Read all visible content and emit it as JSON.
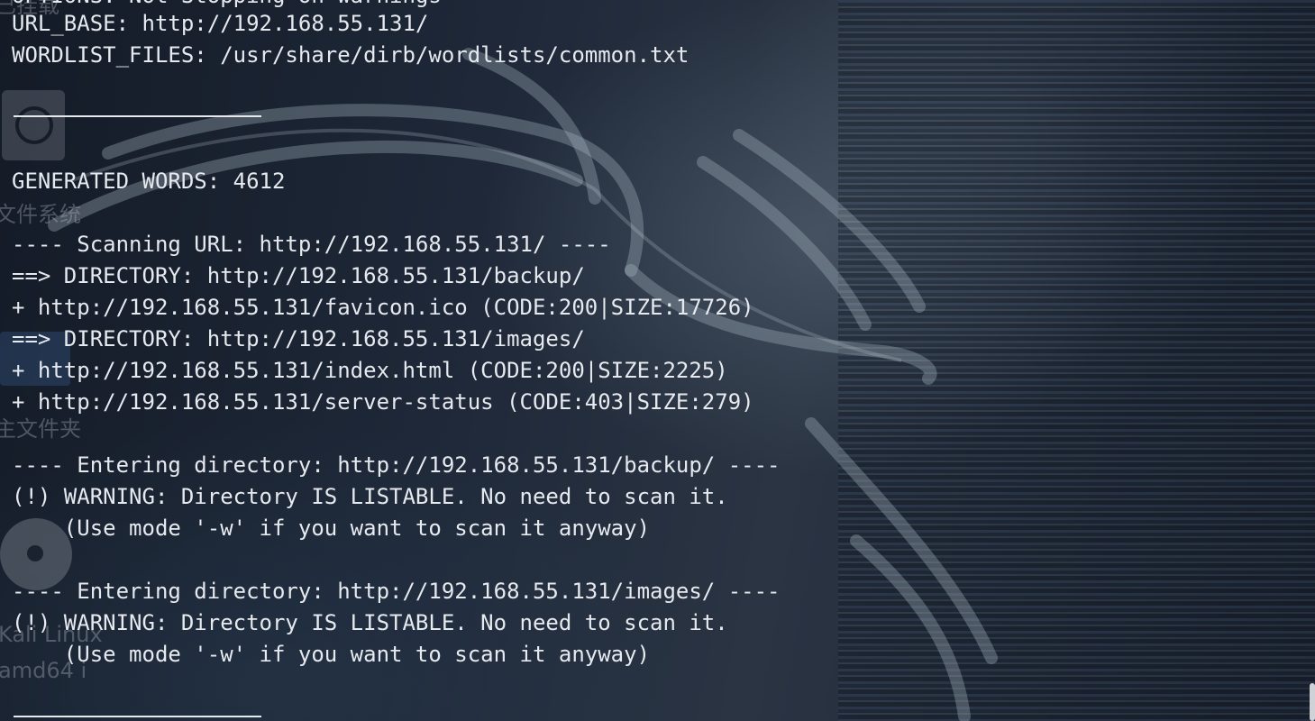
{
  "desktop": {
    "icons": [
      {
        "name": "trash-icon",
        "label": "文件系统"
      },
      {
        "name": "folder-icon",
        "label": "主文件夹"
      },
      {
        "name": "disc-icon",
        "label": "Kali Linux amd64 i"
      }
    ],
    "label_trash": "文件系统",
    "label_home": "主文件夹",
    "label_disc_1": "Kali Linux",
    "label_disc_2": "amd64 i",
    "label_top": "已挂载"
  },
  "terminal": {
    "lines": {
      "top_partial": "OPTIONS: Not Stopping on warnings",
      "url_base": "URL_BASE: http://192.168.55.131/",
      "wordlist": "WORDLIST_FILES: /usr/share/dirb/wordlists/common.txt",
      "generated_words": "GENERATED WORDS: 4612",
      "scanning": "---- Scanning URL: http://192.168.55.131/ ----",
      "dir_backup": "==> DIRECTORY: http://192.168.55.131/backup/",
      "favicon": "+ http://192.168.55.131/favicon.ico (CODE:200|SIZE:17726)",
      "dir_images": "==> DIRECTORY: http://192.168.55.131/images/",
      "index": "+ http://192.168.55.131/index.html (CODE:200|SIZE:2225)",
      "server_status": "+ http://192.168.55.131/server-status (CODE:403|SIZE:279)",
      "enter_backup": "---- Entering directory: http://192.168.55.131/backup/ ----",
      "warn_1": "(!) WARNING: Directory IS LISTABLE. No need to scan it.",
      "use_mode_1": "    (Use mode '-w' if you want to scan it anyway)",
      "enter_images": "---- Entering directory: http://192.168.55.131/images/ ----",
      "warn_2": "(!) WARNING: Directory IS LISTABLE. No need to scan it.",
      "use_mode_2": "    (Use mode '-w' if you want to scan it anyway)"
    }
  },
  "colors": {
    "terminal_text": "#e6e9ee",
    "background": "#1c2431"
  }
}
